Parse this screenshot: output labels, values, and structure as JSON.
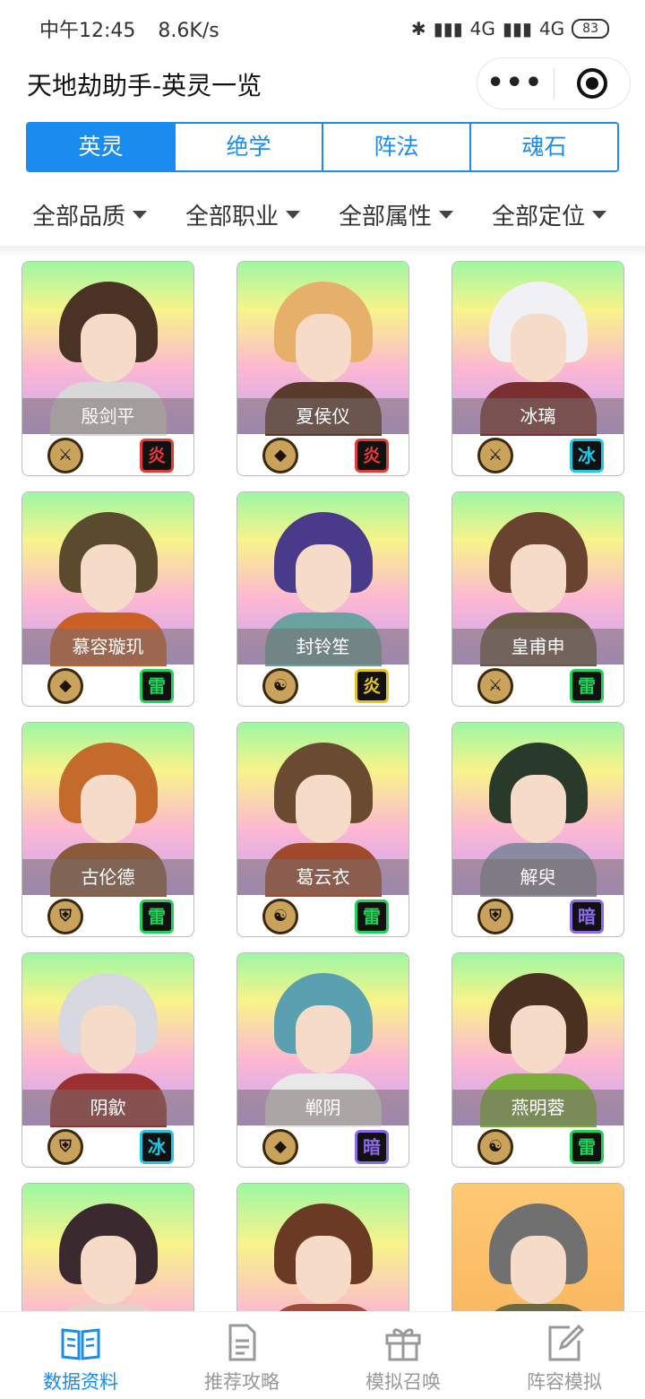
{
  "status": {
    "time": "中午12:45",
    "speed": "8.6K/s",
    "net1": "4G",
    "net2": "4G",
    "battery": "83"
  },
  "app": {
    "title": "天地劫助手-英灵一览",
    "more": "•••"
  },
  "tabs": [
    {
      "label": "英灵",
      "active": true
    },
    {
      "label": "绝学"
    },
    {
      "label": "阵法"
    },
    {
      "label": "魂石"
    }
  ],
  "filters": [
    "全部品质",
    "全部职业",
    "全部属性",
    "全部定位"
  ],
  "heroes": [
    {
      "name": "殷剑平",
      "cls": "⚔",
      "elem": "炎",
      "elemColor": "#e53935",
      "hair": "#4a3325",
      "body": "#d8d8d8",
      "bg": "rainbow"
    },
    {
      "name": "夏侯仪",
      "cls": "◆",
      "elem": "炎",
      "elemColor": "#e53935",
      "hair": "#e6b06a",
      "body": "#5a3b2b",
      "bg": "rainbow"
    },
    {
      "name": "冰璃",
      "cls": "⚔",
      "elem": "冰",
      "elemColor": "#1ec8e6",
      "hair": "#f0f0f5",
      "body": "#7a3030",
      "bg": "rainbow"
    },
    {
      "name": "慕容璇玑",
      "cls": "◆",
      "elem": "雷",
      "elemColor": "#1fd35a",
      "hair": "#5a4a2e",
      "body": "#c86028",
      "bg": "rainbow"
    },
    {
      "name": "封铃笙",
      "cls": "☯",
      "elem": "炎",
      "elemColor": "#e6c420",
      "hair": "#4a3a8a",
      "body": "#6aa2a0",
      "bg": "rainbow"
    },
    {
      "name": "皇甫申",
      "cls": "⚔",
      "elem": "雷",
      "elemColor": "#1fd35a",
      "hair": "#6a4230",
      "body": "#6a5a48",
      "bg": "rainbow"
    },
    {
      "name": "古伦德",
      "cls": "⛨",
      "elem": "雷",
      "elemColor": "#1fd35a",
      "hair": "#c46a2a",
      "body": "#8a5a3a",
      "bg": "rainbow"
    },
    {
      "name": "葛云衣",
      "cls": "☯",
      "elem": "雷",
      "elemColor": "#1fd35a",
      "hair": "#6a4a30",
      "body": "#a04a2a",
      "bg": "rainbow"
    },
    {
      "name": "解臾",
      "cls": "⛨",
      "elem": "暗",
      "elemColor": "#8a6ae6",
      "hair": "#2a3a2a",
      "body": "#8a8aa0",
      "bg": "rainbow"
    },
    {
      "name": "阴歙",
      "cls": "⛨",
      "elem": "冰",
      "elemColor": "#1ec8e6",
      "hair": "#d8d8e0",
      "body": "#9a3030",
      "bg": "rainbow"
    },
    {
      "name": "郸阴",
      "cls": "◆",
      "elem": "暗",
      "elemColor": "#8a6ae6",
      "hair": "#5aa0b0",
      "body": "#e8e8e8",
      "bg": "rainbow"
    },
    {
      "name": "燕明蓉",
      "cls": "☯",
      "elem": "雷",
      "elemColor": "#1fd35a",
      "hair": "#4a3020",
      "body": "#7ab03a",
      "bg": "rainbow"
    },
    {
      "name": "",
      "cls": "",
      "elem": "",
      "elemColor": "#000",
      "hair": "#3a2a30",
      "body": "#e8d0c8",
      "bg": "rainbow"
    },
    {
      "name": "",
      "cls": "",
      "elem": "",
      "elemColor": "#000",
      "hair": "#6a3a25",
      "body": "#a04a3a",
      "bg": "rainbow"
    },
    {
      "name": "",
      "cls": "",
      "elem": "",
      "elemColor": "#000",
      "hair": "#707070",
      "body": "#6a6a40",
      "bg": "gold"
    }
  ],
  "bottom_nav": [
    {
      "label": "数据资料",
      "icon": "book-icon",
      "active": true
    },
    {
      "label": "推荐攻略",
      "icon": "document-icon"
    },
    {
      "label": "模拟召唤",
      "icon": "gift-icon"
    },
    {
      "label": "阵容模拟",
      "icon": "edit-icon"
    }
  ]
}
